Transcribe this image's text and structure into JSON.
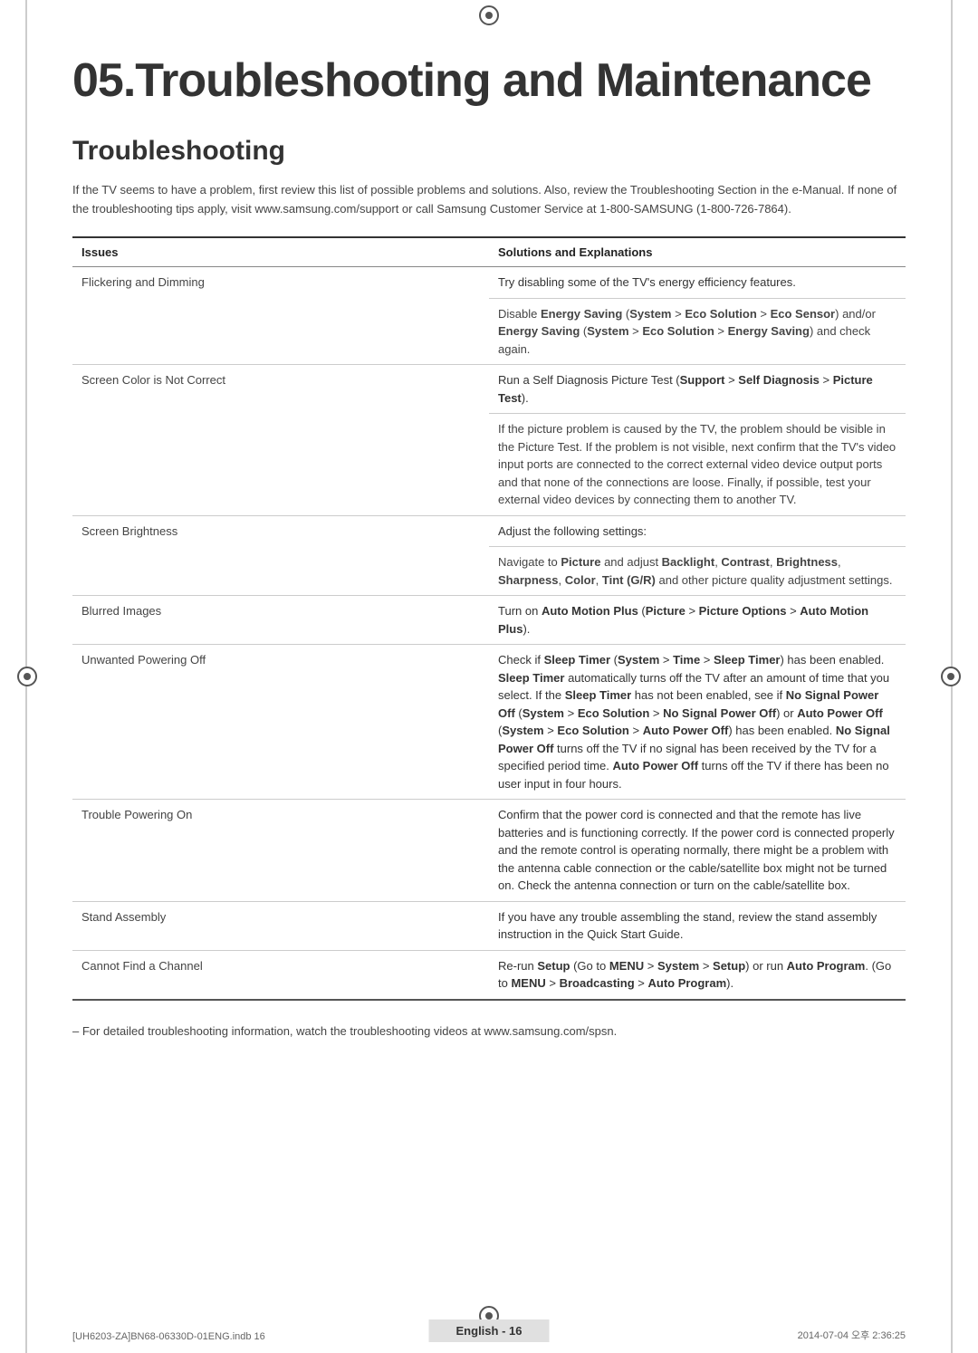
{
  "page": {
    "chapter_title": "05.Troubleshooting and Maintenance",
    "section_title": "Troubleshooting",
    "intro_text": "If the TV seems to have a problem, first review this list of possible problems and solutions. Also, review the Troubleshooting Section in the e-Manual. If none of the troubleshooting tips apply, visit www.samsung.com/support or call Samsung Customer Service at 1-800-SAMSUNG (1-800-726-7864).",
    "table": {
      "headers": [
        "Issues",
        "Solutions and Explanations"
      ],
      "rows": [
        {
          "issue": "Flickering and Dimming",
          "solutions": [
            "Try disabling some of the TV's energy efficiency features.",
            "Disable Energy Saving (System > Eco Solution > Eco Sensor) and/or Energy Saving (System > Eco Solution > Energy Saving) and check again."
          ]
        },
        {
          "issue": "Screen Color is Not Correct",
          "solutions": [
            "Run a Self Diagnosis Picture Test (Support > Self Diagnosis > Picture Test).",
            "If the picture problem is caused by the TV, the problem should be visible in the Picture Test. If the problem is not visible, next confirm that the TV's video input ports are connected to the correct external video device output ports and that none of the connections are loose. Finally, if possible, test your external video devices by connecting them to another TV."
          ]
        },
        {
          "issue": "Screen Brightness",
          "solutions": [
            "Adjust the following settings:",
            "Navigate to Picture and adjust Backlight, Contrast, Brightness, Sharpness, Color, Tint (G/R) and other picture quality adjustment settings."
          ]
        },
        {
          "issue": "Blurred Images",
          "solutions": [
            "Turn on Auto Motion Plus (Picture > Picture Options > Auto Motion Plus)."
          ]
        },
        {
          "issue": "Unwanted Powering Off",
          "solutions": [
            "Check if Sleep Timer (System > Time > Sleep Timer) has been enabled. Sleep Timer automatically turns off the TV after an amount of time that you select. If the Sleep Timer has not been enabled, see if No Signal Power Off (System > Eco Solution > No Signal Power Off) or Auto Power Off (System > Eco Solution > Auto Power Off) has been enabled. No Signal Power Off turns off the TV if no signal has been received by the TV for a specified period time. Auto Power Off turns off the TV if there has been no user input in four hours."
          ]
        },
        {
          "issue": "Trouble Powering On",
          "solutions": [
            "Confirm that the power cord is connected and that the remote has live batteries and is functioning correctly. If the power cord is connected properly and the remote control is operating normally, there might be a problem with the antenna cable connection or the cable/satellite box might not be turned on. Check the antenna connection or turn on the cable/satellite box."
          ]
        },
        {
          "issue": "Stand Assembly",
          "solutions": [
            "If you have any trouble assembling the stand, review the stand assembly instruction in the Quick Start Guide."
          ]
        },
        {
          "issue": "Cannot Find a Channel",
          "solutions": [
            "Re-run Setup (Go to MENU > System > Setup) or run Auto Program. (Go to MENU > Broadcasting > Auto Program)."
          ]
        }
      ]
    },
    "note": "– For detailed troubleshooting information, watch the troubleshooting videos at www.samsung.com/spsn.",
    "footer": {
      "left": "[UH6203-ZA]BN68-06330D-01ENG.indb   16",
      "center": "English - 16",
      "right": "2014-07-04   오후 2:36:25"
    }
  }
}
